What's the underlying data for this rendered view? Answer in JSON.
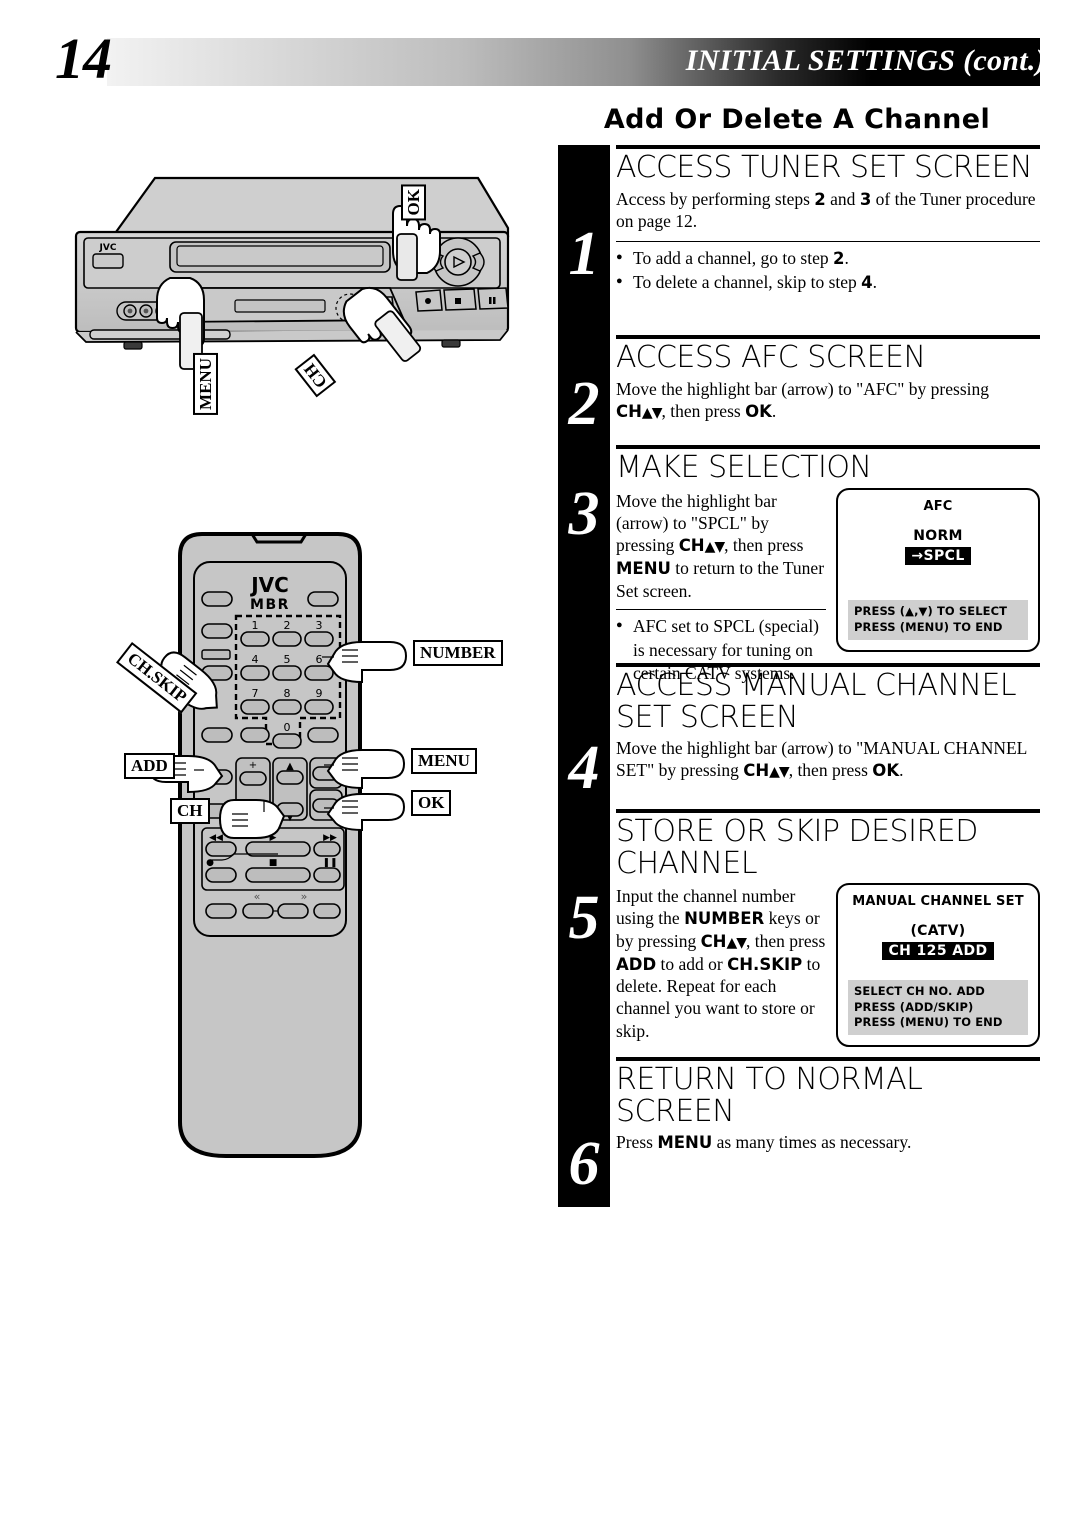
{
  "header": {
    "page_number": "14",
    "section_title": "INITIAL SETTINGS (cont.)",
    "sub_title": "Add Or Delete A Channel"
  },
  "steps": [
    {
      "number": "1",
      "heading": "ACCESS TUNER SET SCREEN",
      "body": "Access by performing steps 2 and 3 of the Tuner procedure on page 12.",
      "bullets": [
        "To add a channel, go to step 2.",
        "To delete a channel, skip to step 4."
      ]
    },
    {
      "number": "2",
      "heading": "ACCESS AFC SCREEN",
      "body": "Move the highlight bar (arrow) to \"AFC\" by pressing CH▲▼, then press OK."
    },
    {
      "number": "3",
      "heading": "MAKE SELECTION",
      "body": "Move the highlight bar (arrow) to \"SPCL\" by pressing CH▲▼, then press MENU to return to the Tuner Set screen.",
      "bullets": [
        "AFC set to SPCL (special) is necessary for tuning on certain CATV systems."
      ]
    },
    {
      "number": "4",
      "heading": "ACCESS MANUAL CHANNEL SET SCREEN",
      "body": "Move the highlight bar (arrow) to \"MANUAL CHANNEL SET\" by pressing CH▲▼, then press OK."
    },
    {
      "number": "5",
      "heading": "STORE OR SKIP DESIRED CHANNEL",
      "body": "Input the channel number using the NUMBER keys or by pressing CH▲▼, then press ADD to add or CH.SKIP to delete. Repeat for each channel you want to store or skip."
    },
    {
      "number": "6",
      "heading": "RETURN TO NORMAL SCREEN",
      "body": "Press MENU as many times as necessary."
    }
  ],
  "osd_afc": {
    "title": "AFC",
    "option_norm": "NORM",
    "option_spcl": "SPCL",
    "cursor": "→",
    "footer_line1": "PRESS (▲,▼) TO SELECT",
    "footer_line2": "PRESS (MENU) TO END"
  },
  "osd_manual": {
    "title": "MANUAL CHANNEL SET",
    "band": "(CATV)",
    "channel": "CH 125 ADD",
    "footer_line1": "SELECT CH NO. ADD",
    "footer_line2": "PRESS (ADD/SKIP)",
    "footer_line3": "PRESS (MENU) TO END"
  },
  "vcr": {
    "brand": "JVC",
    "callout_ok": "OK",
    "callout_menu": "MENU",
    "callout_ch": "CH"
  },
  "remote": {
    "brand": "JVC",
    "model": "MBR",
    "keys": [
      "1",
      "2",
      "3",
      "4",
      "5",
      "6",
      "7",
      "8",
      "9",
      "0"
    ],
    "callout_number": "NUMBER",
    "callout_chskip": "CH.SKIP",
    "callout_add": "ADD",
    "callout_ch": "CH",
    "callout_menu": "MENU",
    "callout_ok": "OK",
    "transport": {
      "rew": "◀◀",
      "play": "▶",
      "ff": "▶▶",
      "rec": "●",
      "stop": "■",
      "pause": "❙❙",
      "slow_back": "«",
      "slow_fwd": "»"
    },
    "ch_up": "▲",
    "ch_down": "▼",
    "vol_up": "+",
    "vol_down": "–"
  },
  "colors": {
    "ink": "#000000",
    "panel_gray": "#c6c6c6",
    "screen_footer_gray": "#cfcfcf"
  }
}
